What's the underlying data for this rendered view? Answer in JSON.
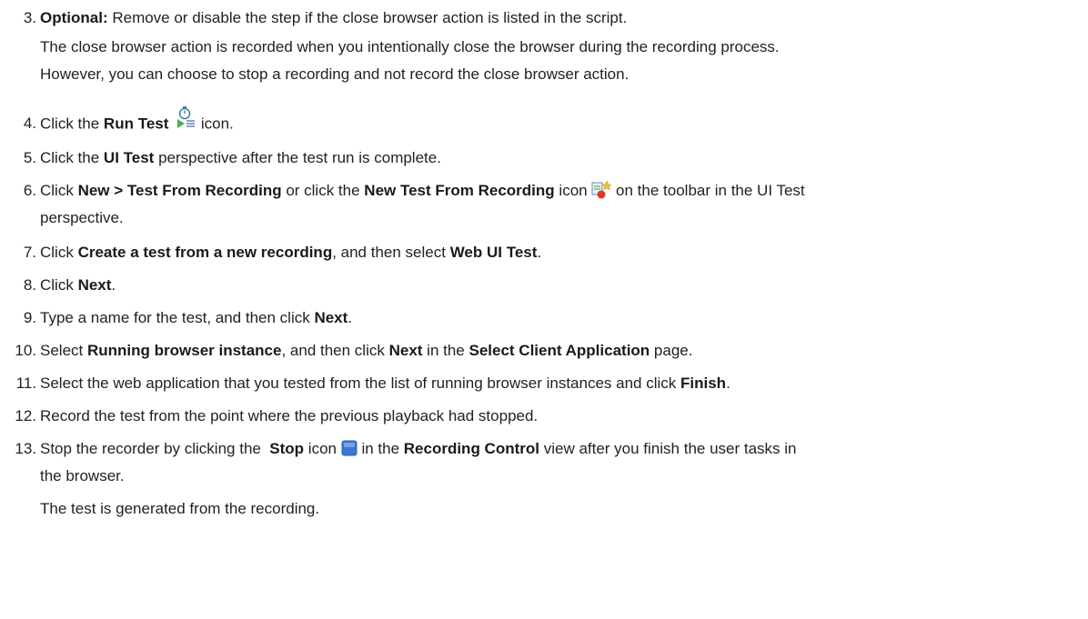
{
  "steps": {
    "s3": {
      "num": "3.",
      "bold": "Optional:",
      "text": " Remove or disable the step if the close browser action is listed in the script.",
      "para1": "The close browser action is recorded when you intentionally close the browser during the recording process.",
      "para2": "However, you can choose to stop a recording and not record the close browser action."
    },
    "s4": {
      "num": "4.",
      "pre": "Click the ",
      "bold": "Run Test",
      "post": " icon.",
      "icon": "run-test-icon"
    },
    "s5": {
      "num": "5.",
      "pre": "Click the ",
      "bold": "UI Test",
      "post": " perspective after the test run is complete."
    },
    "s6": {
      "num": "6.",
      "pre": "Click ",
      "bold1": "New > Test From Recording",
      "mid": " or click the ",
      "bold2": "New Test From Recording",
      "post1": " icon ",
      "post2": " on the toolbar in the UI Test",
      "line2": "perspective.",
      "icon": "new-test-from-recording-icon"
    },
    "s7": {
      "num": "7.",
      "pre": "Click ",
      "bold1": "Create a test from a new recording",
      "mid": ", and then select ",
      "bold2": "Web UI Test",
      "post": "."
    },
    "s8": {
      "num": "8.",
      "pre": "Click ",
      "bold": "Next",
      "post": "."
    },
    "s9": {
      "num": "9.",
      "pre": "Type a name for the test, and then click ",
      "bold": "Next",
      "post": "."
    },
    "s10": {
      "num": "10.",
      "pre": "Select ",
      "bold1": "Running browser instance",
      "mid": ", and then click ",
      "bold2": "Next",
      "mid2": " in the ",
      "bold3": "Select Client Application",
      "post": " page."
    },
    "s11": {
      "num": "11.",
      "pre": "Select the web application that you tested from the list of running browser instances and click ",
      "bold": "Finish",
      "post": "."
    },
    "s12": {
      "num": "12.",
      "text": "Record the test from the point where the previous playback had stopped."
    },
    "s13": {
      "num": "13.",
      "pre": "Stop the recorder by clicking the  ",
      "bold1": "Stop",
      "mid": " icon ",
      "mid2": " in the ",
      "bold2": "Recording Control",
      "post": " view after you finish the user tasks in",
      "line2": "the browser.",
      "result": "The test is generated from the recording.",
      "icon": "stop-icon"
    }
  },
  "colors": {
    "text": "#222222",
    "stop_icon": "#3a78d4",
    "record_dot": "#e0382f",
    "run_green": "#4caf50"
  }
}
